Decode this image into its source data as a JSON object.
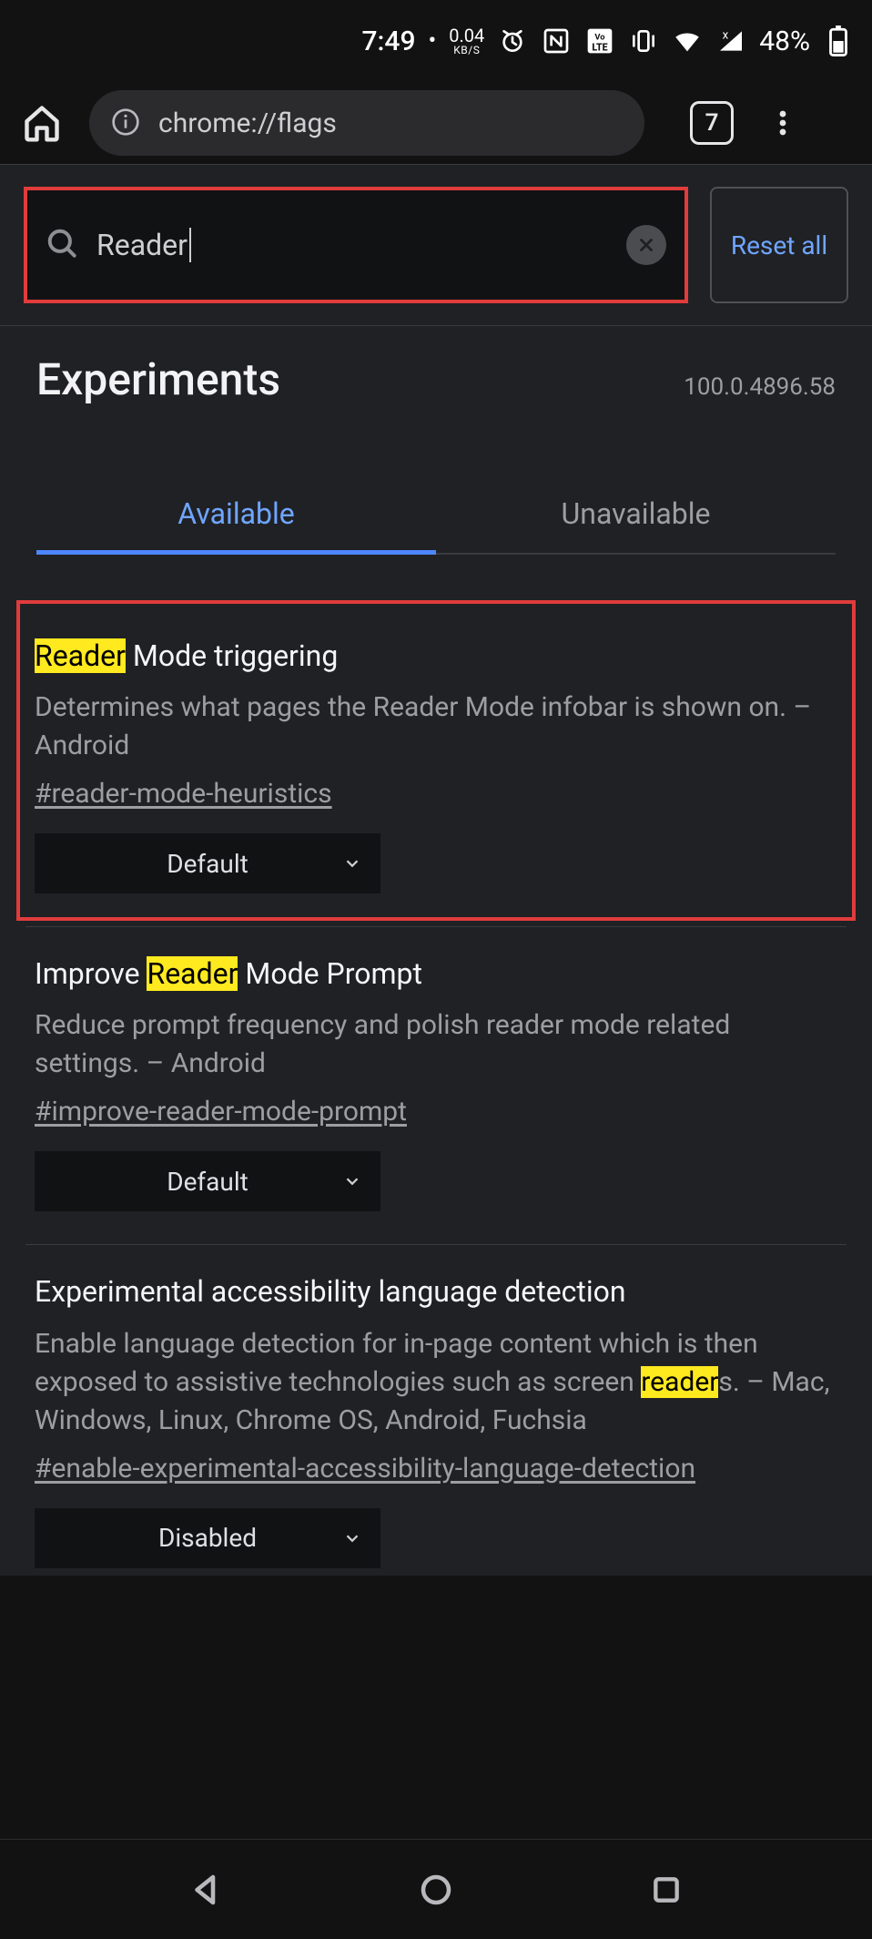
{
  "status": {
    "time": "7:49",
    "net_speed": "0.04",
    "net_unit": "KB/S",
    "battery_pct": "48%"
  },
  "toolbar": {
    "url_display": "chrome://flags",
    "tab_count": "7"
  },
  "search": {
    "value": "Reader",
    "reset_label": "Reset all"
  },
  "header": {
    "title": "Experiments",
    "version": "100.0.4896.58"
  },
  "tabs": {
    "available": "Available",
    "unavailable": "Unavailable"
  },
  "flags": [
    {
      "title_pre": "",
      "title_hl": "Reader",
      "title_post": " Mode triggering",
      "desc": "Determines what pages the Reader Mode infobar is shown on. – Android",
      "hash": "#reader-mode-heuristics",
      "value": "Default",
      "boxed": true
    },
    {
      "title_pre": "Improve ",
      "title_hl": "Reader",
      "title_post": " Mode Prompt",
      "desc": "Reduce prompt frequency and polish reader mode related settings. – Android",
      "hash": "#improve-reader-mode-prompt",
      "value": "Default",
      "boxed": false
    },
    {
      "title_pre": "Experimental accessibility language detection",
      "title_hl": "",
      "title_post": "",
      "desc_pre": "Enable language detection for in-page content which is then exposed to assistive technologies such as screen ",
      "desc_hl": "reader",
      "desc_post": "s. – Mac, Windows, Linux, Chrome OS, Android, Fuchsia",
      "hash": "#enable-experimental-accessibility-language-detection",
      "value": "Disabled",
      "boxed": false
    }
  ]
}
